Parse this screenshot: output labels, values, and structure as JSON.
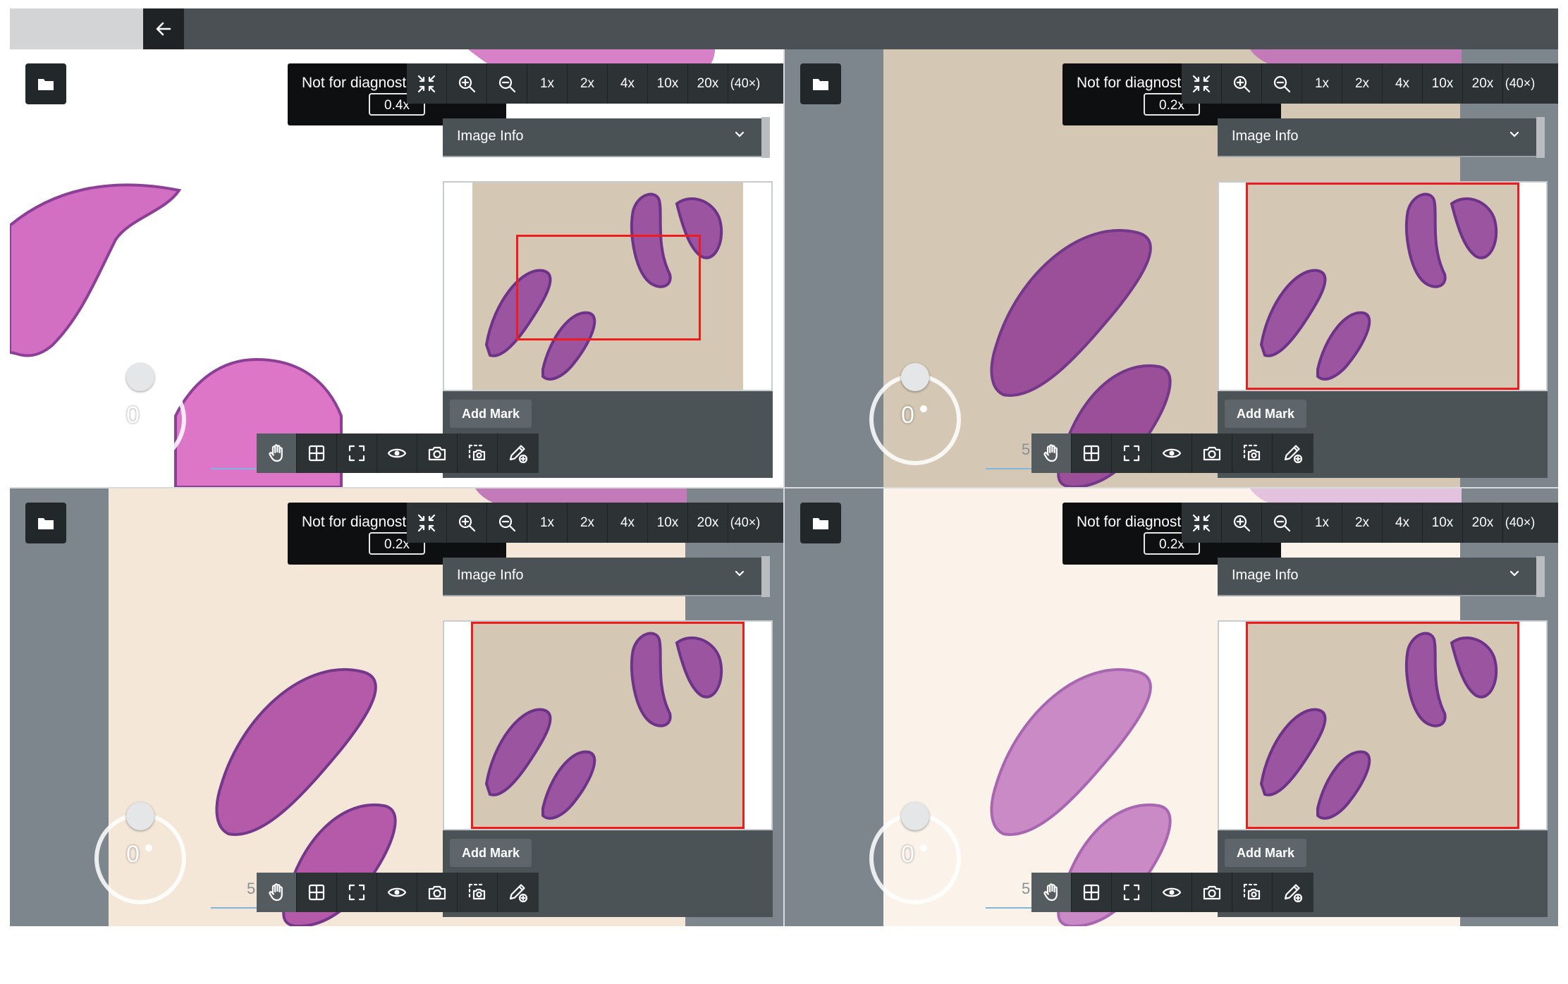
{
  "app": {
    "back_icon": "arrow-left-icon",
    "folder_icon": "folder-icon"
  },
  "viewers": [
    {
      "id": "viewer-1",
      "not_for_diagnosis": "Not for diagnost",
      "magnification": "0.4x",
      "zoom_levels": [
        "1x",
        "2x",
        "4x",
        "10x",
        "20x",
        "(40×)"
      ],
      "image_info_label": "Image Info",
      "add_mark_label": "Add Mark",
      "rotation": "0",
      "scale_label": ""
    },
    {
      "id": "viewer-2",
      "not_for_diagnosis": "Not for diagnost",
      "magnification": "0.2x",
      "zoom_levels": [
        "1x",
        "2x",
        "4x",
        "10x",
        "20x",
        "(40×)"
      ],
      "image_info_label": "Image Info",
      "add_mark_label": "Add Mark",
      "rotation": "0",
      "scale_label": "5"
    },
    {
      "id": "viewer-3",
      "not_for_diagnosis": "Not for diagnost",
      "magnification": "0.2x",
      "zoom_levels": [
        "1x",
        "2x",
        "4x",
        "10x",
        "20x",
        "(40×)"
      ],
      "image_info_label": "Image Info",
      "add_mark_label": "Add Mark",
      "rotation": "0",
      "scale_label": "5"
    },
    {
      "id": "viewer-4",
      "not_for_diagnosis": "Not for diagnost",
      "magnification": "0.2x",
      "zoom_levels": [
        "1x",
        "2x",
        "4x",
        "10x",
        "20x",
        "(40×)"
      ],
      "image_info_label": "Image Info",
      "add_mark_label": "Add Mark",
      "rotation": "0",
      "scale_label": "5"
    }
  ],
  "toolbar_icons": [
    "fit-screen-icon",
    "zoom-in-icon",
    "zoom-out-icon"
  ],
  "bottom_tools": [
    "pan-hand-icon",
    "grid-icon",
    "fullscreen-icon",
    "eye-icon",
    "camera-icon",
    "region-capture-icon",
    "annotate-pen-icon"
  ],
  "colors": {
    "viewport_rect": "#ee1c1c",
    "toolbar_bg": "#2d3235",
    "tissue_stain": "#b0509a"
  }
}
